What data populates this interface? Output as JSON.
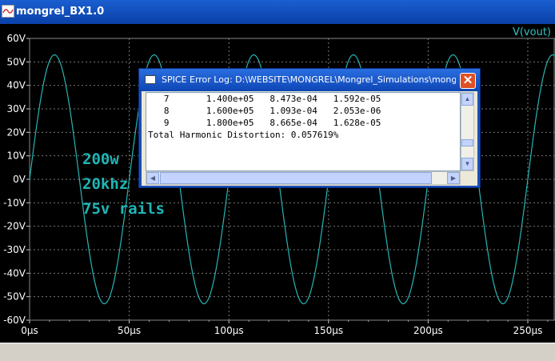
{
  "window": {
    "title": "mongrel_BX1.0"
  },
  "plot": {
    "trace_label": "V(vout)",
    "trace_color": "#27b5b5",
    "grid_color": "#7a7a7a",
    "annotations": [
      "200w",
      "20khz",
      "75v rails"
    ],
    "y_ticks": [
      "60V",
      "50V",
      "40V",
      "30V",
      "20V",
      "10V",
      "0V",
      "-10V",
      "-20V",
      "-30V",
      "-40V",
      "-50V",
      "-60V"
    ],
    "x_ticks": [
      "0µs",
      "50µs",
      "100µs",
      "150µs",
      "200µs",
      "250µs"
    ]
  },
  "chart_data": {
    "type": "line",
    "series": [
      {
        "name": "V(vout)",
        "amplitude": 53,
        "frequency_hz": 20000,
        "phase_deg": 0
      }
    ],
    "x_range_us": [
      0,
      265
    ],
    "ylim": [
      -60,
      60
    ],
    "xlabel": "",
    "ylabel": "",
    "grid": true
  },
  "dialog": {
    "title": "SPICE Error Log: D:\\WEBSITE\\MONGREL\\Mongrel_Simulations\\mongr...",
    "close_label": "✕",
    "log_lines": [
      "   7       1.400e+05   8.473e-04   1.592e-05",
      "   8       1.600e+05   1.093e-04   2.053e-06",
      "   9       1.800e+05   8.665e-04   1.628e-05",
      "Total Harmonic Distortion: 0.057619%"
    ]
  }
}
